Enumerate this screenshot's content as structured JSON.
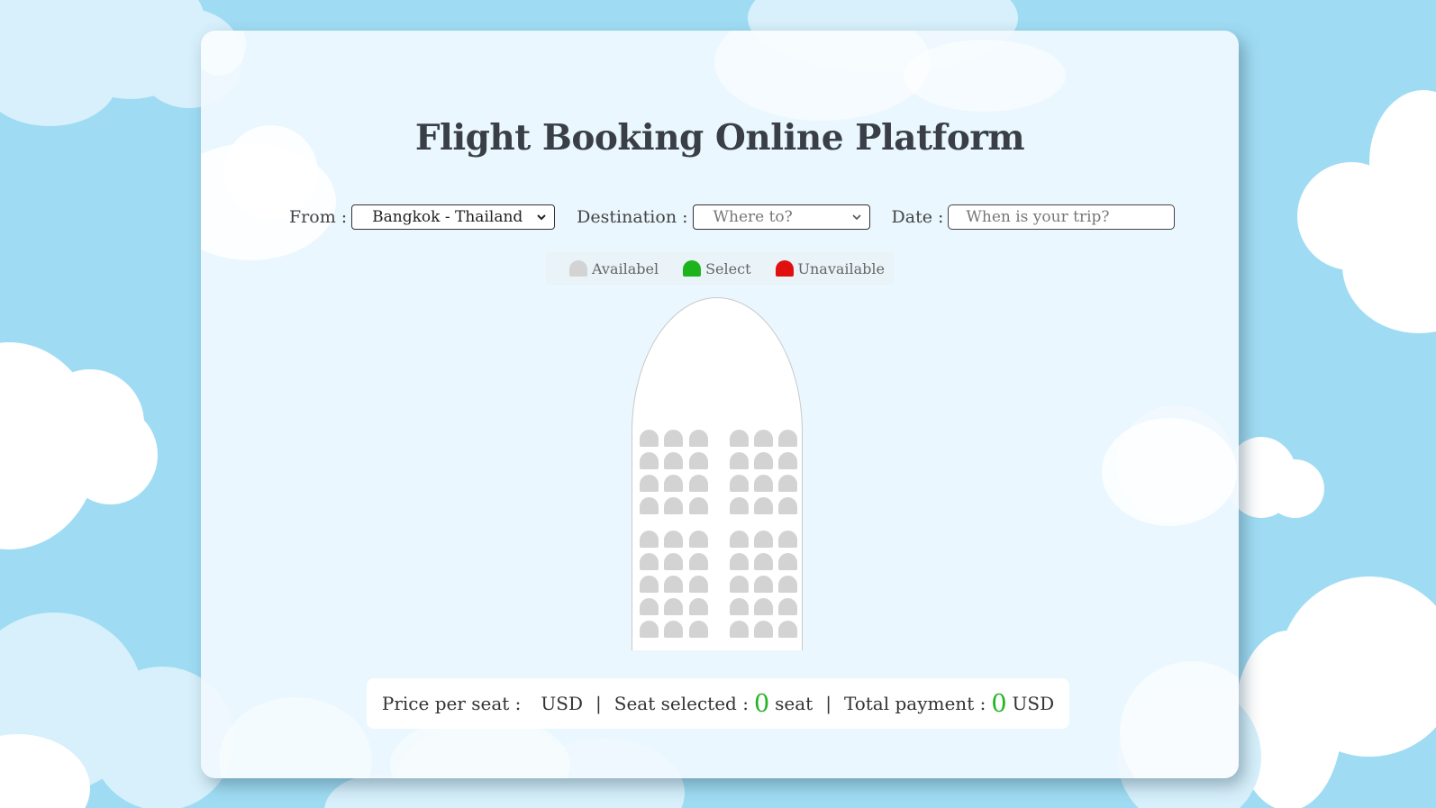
{
  "app": {
    "title": "Flight Booking Online Platform"
  },
  "search": {
    "from_label": "From :",
    "from_value": "Bangkok - Thailand",
    "destination_label": "Destination :",
    "destination_placeholder": "Where to?",
    "date_label": "Date :",
    "date_placeholder": "When is your trip?"
  },
  "legend": {
    "items": [
      {
        "label": "Availabel",
        "color": "#d3d3d3"
      },
      {
        "label": "Select",
        "color": "#1db31d"
      },
      {
        "label": "Unavailable",
        "color": "#e01010"
      }
    ]
  },
  "seat_map": {
    "rows": 9,
    "seats_per_row": 6,
    "status": "all available"
  },
  "summary": {
    "price_label": "Price per seat :",
    "price_value": "",
    "price_currency": "USD",
    "separator": "|",
    "seats_label": "Seat selected :",
    "seats_count": "0",
    "seats_unit": "seat",
    "total_label": "Total payment :",
    "total_value": "0",
    "total_currency": "USD"
  },
  "colors": {
    "accent_green": "#22b522",
    "background_sky": "#9fdcf3",
    "seat_available": "#d3d3d3"
  }
}
